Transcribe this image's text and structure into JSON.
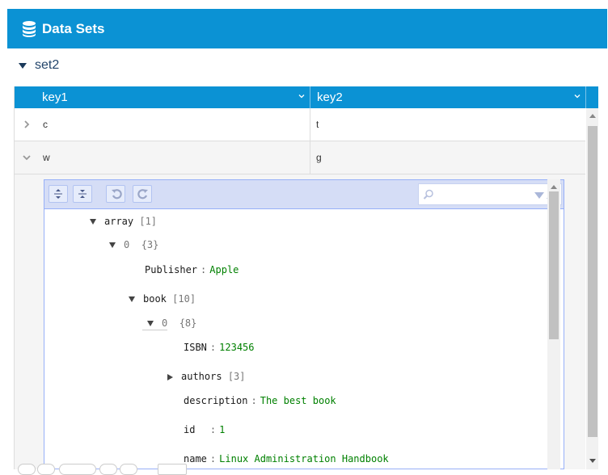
{
  "header": {
    "title": "Data Sets",
    "icon": "database-icon"
  },
  "set": {
    "name": "set2"
  },
  "grid": {
    "columns": [
      "key1",
      "key2"
    ],
    "rows": [
      {
        "key1": "c",
        "key2": "t",
        "expanded": false
      },
      {
        "key1": "w",
        "key2": "g",
        "expanded": true
      }
    ]
  },
  "editor": {
    "search": {
      "value": ""
    },
    "tree": {
      "root_key": "array",
      "root_count": "[1]",
      "item0_key": "0",
      "item0_count": "{3}",
      "publisher_key": "Publisher",
      "publisher_value": "Apple",
      "book_key": "book",
      "book_count": "[10]",
      "book0_key": "0",
      "book0_count": "{8}",
      "isbn_key": "ISBN",
      "isbn_value": "123456",
      "authors_key": "authors",
      "authors_count": "[3]",
      "description_key": "description",
      "description_value": "The best book",
      "id_key": "id",
      "id_value": "1",
      "name_key": "name",
      "name_value": "Linux Administration Handbook"
    }
  },
  "colors": {
    "accent": "#0b92d4",
    "string": "#008000",
    "number": "#ee422e"
  }
}
